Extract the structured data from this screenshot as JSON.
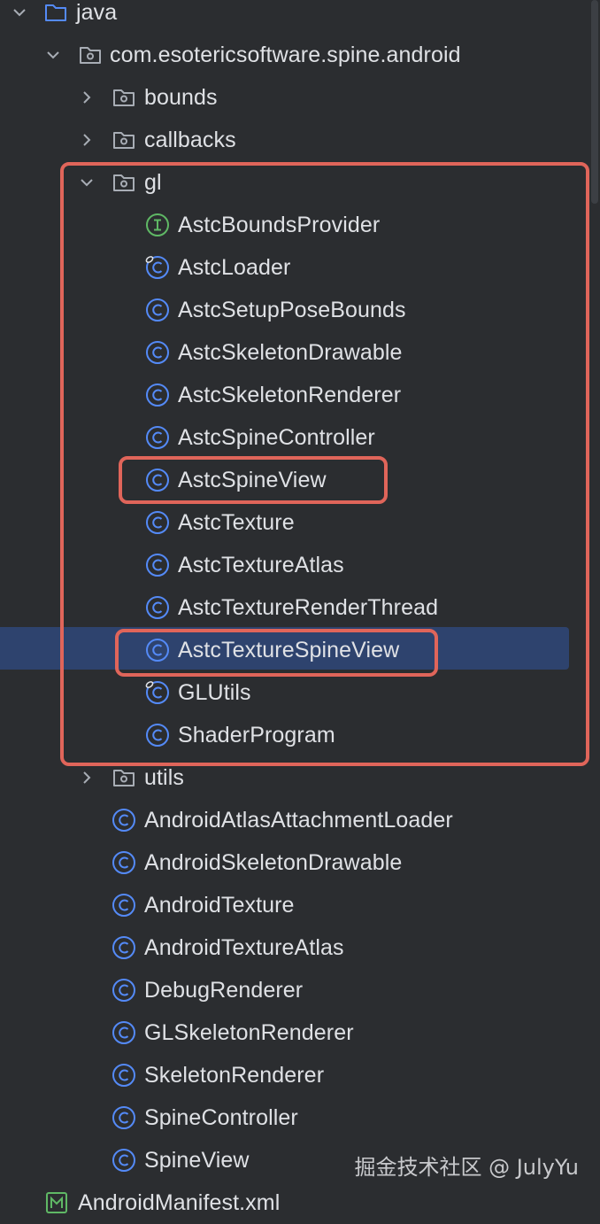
{
  "tree": {
    "rows": [
      {
        "id": "java",
        "label": "java",
        "icon": "folder-icon",
        "chevron": "down"
      },
      {
        "id": "pkg-android",
        "label": "com.esotericsoftware.spine.android",
        "icon": "package-icon",
        "chevron": "down"
      },
      {
        "id": "bounds",
        "label": "bounds",
        "icon": "package-icon",
        "chevron": "right"
      },
      {
        "id": "callbacks",
        "label": "callbacks",
        "icon": "package-icon",
        "chevron": "right"
      },
      {
        "id": "gl",
        "label": "gl",
        "icon": "package-icon",
        "chevron": "down"
      },
      {
        "id": "AstcBoundsProvider",
        "label": "AstcBoundsProvider",
        "icon": "interface-icon"
      },
      {
        "id": "AstcLoader",
        "label": "AstcLoader",
        "icon": "class-icon"
      },
      {
        "id": "AstcSetupPoseBounds",
        "label": "AstcSetupPoseBounds",
        "icon": "class-icon"
      },
      {
        "id": "AstcSkeletonDrawable",
        "label": "AstcSkeletonDrawable",
        "icon": "class-icon"
      },
      {
        "id": "AstcSkeletonRenderer",
        "label": "AstcSkeletonRenderer",
        "icon": "class-icon"
      },
      {
        "id": "AstcSpineController",
        "label": "AstcSpineController",
        "icon": "class-icon"
      },
      {
        "id": "AstcSpineView",
        "label": "AstcSpineView",
        "icon": "class-icon"
      },
      {
        "id": "AstcTexture",
        "label": "AstcTexture",
        "icon": "class-icon"
      },
      {
        "id": "AstcTextureAtlas",
        "label": "AstcTextureAtlas",
        "icon": "class-icon"
      },
      {
        "id": "AstcTextureRenderThread",
        "label": "AstcTextureRenderThread",
        "icon": "class-icon"
      },
      {
        "id": "AstcTextureSpineView",
        "label": "AstcTextureSpineView",
        "icon": "class-icon",
        "selected": true
      },
      {
        "id": "GLUtils",
        "label": "GLUtils",
        "icon": "class-icon"
      },
      {
        "id": "ShaderProgram",
        "label": "ShaderProgram",
        "icon": "class-icon"
      },
      {
        "id": "utils",
        "label": "utils",
        "icon": "package-icon",
        "chevron": "right"
      },
      {
        "id": "AndroidAtlasAttachmentLoader",
        "label": "AndroidAtlasAttachmentLoader",
        "icon": "class-icon"
      },
      {
        "id": "AndroidSkeletonDrawable",
        "label": "AndroidSkeletonDrawable",
        "icon": "class-icon"
      },
      {
        "id": "AndroidTexture",
        "label": "AndroidTexture",
        "icon": "class-icon"
      },
      {
        "id": "AndroidTextureAtlas",
        "label": "AndroidTextureAtlas",
        "icon": "class-icon"
      },
      {
        "id": "DebugRenderer",
        "label": "DebugRenderer",
        "icon": "class-icon"
      },
      {
        "id": "GLSkeletonRenderer",
        "label": "GLSkeletonRenderer",
        "icon": "class-icon"
      },
      {
        "id": "SkeletonRenderer",
        "label": "SkeletonRenderer",
        "icon": "class-icon"
      },
      {
        "id": "SpineController",
        "label": "SpineController",
        "icon": "class-icon"
      },
      {
        "id": "SpineView",
        "label": "SpineView",
        "icon": "class-icon"
      },
      {
        "id": "AndroidManifest",
        "label": "AndroidManifest.xml",
        "icon": "manifest-icon"
      }
    ]
  },
  "watermark": "掘金技术社区 @ JulyYu",
  "colors": {
    "background": "#2b2d30",
    "selection": "#2e436e",
    "annotation": "#e0655a",
    "class_icon": "#548af7",
    "interface_icon": "#5fb865",
    "manifest_icon": "#5fb865"
  }
}
